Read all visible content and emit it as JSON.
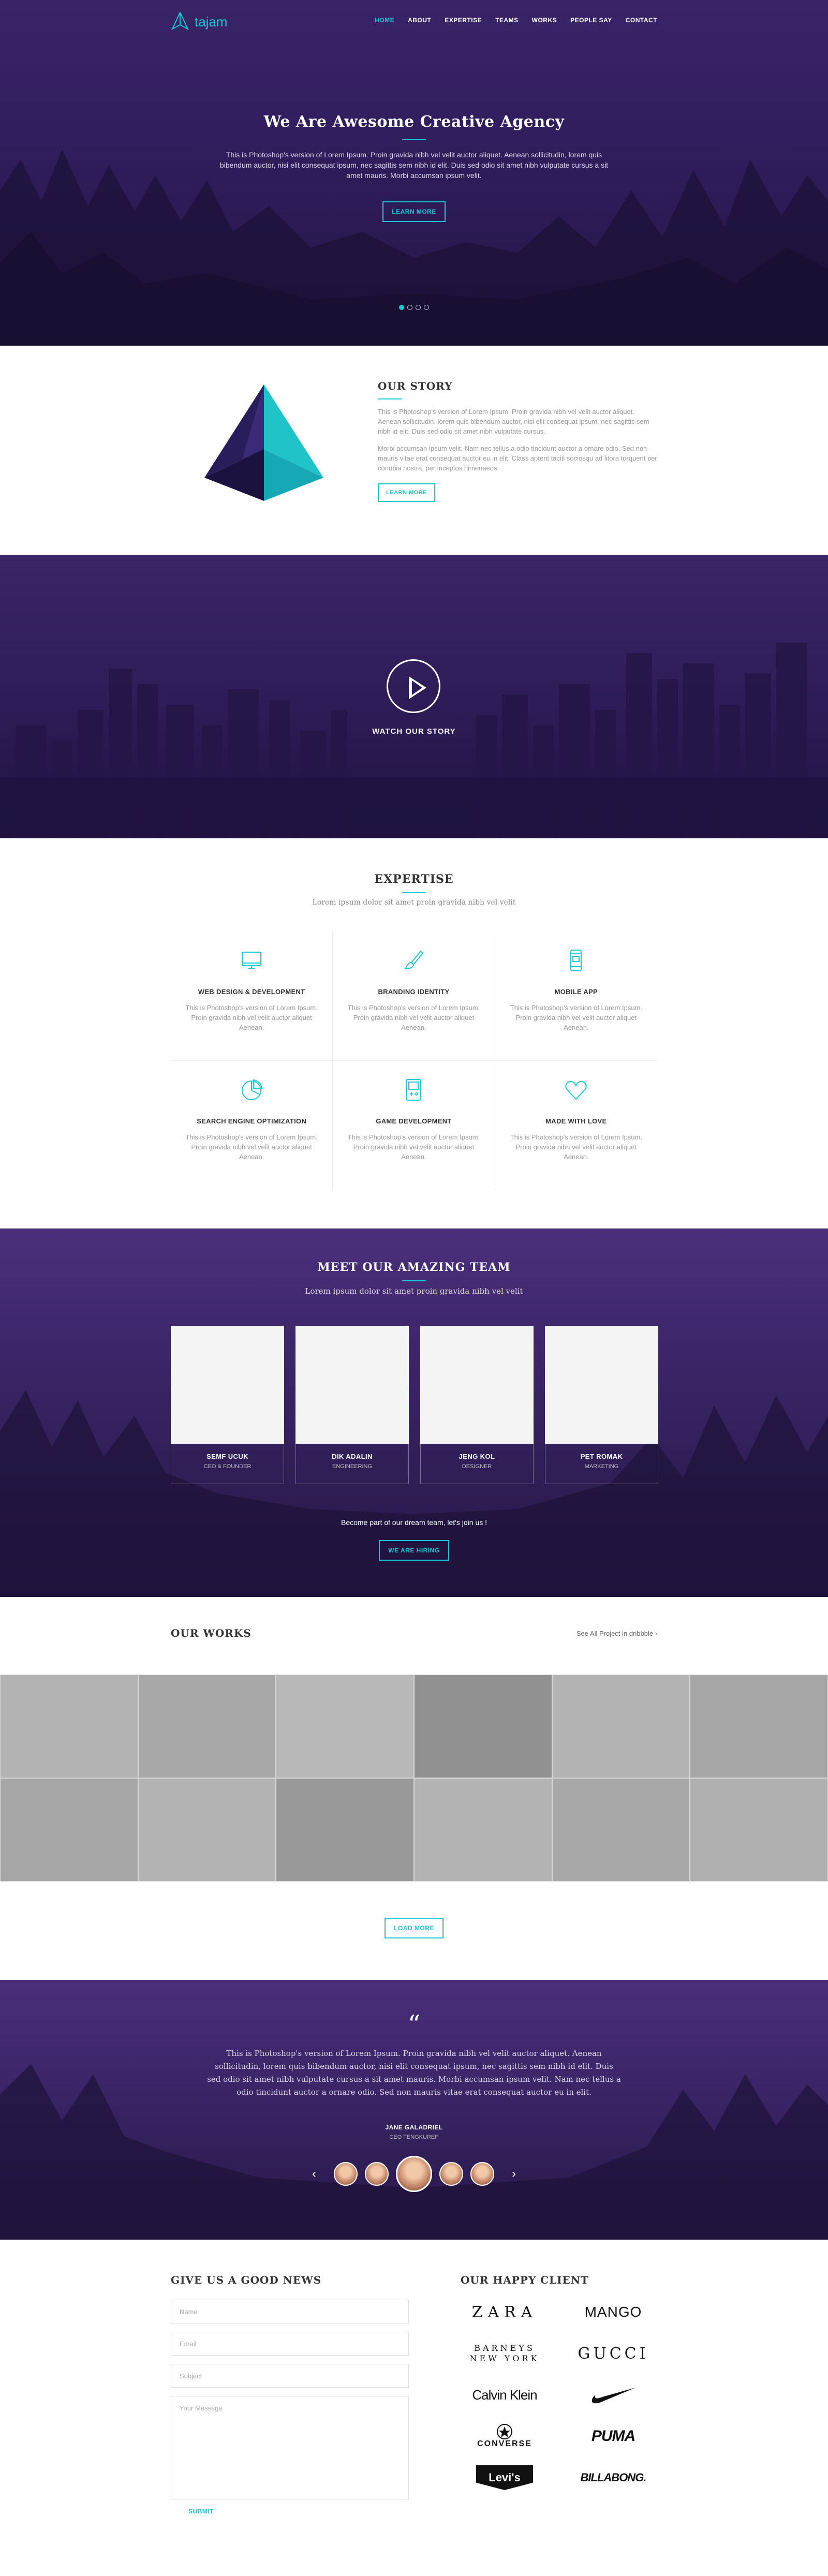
{
  "nav": {
    "logo": "tajam",
    "items": [
      "HOME",
      "ABOUT",
      "EXPERTISE",
      "TEAMS",
      "WORKS",
      "PEOPLE SAY",
      "CONTACT"
    ],
    "active": "HOME"
  },
  "hero": {
    "title": "We Are Awesome Creative Agency",
    "text": "This is Photoshop's version  of Lorem Ipsum. Proin gravida nibh vel velit auctor aliquet. Aenean sollicitudin, lorem quis bibendum auctor, nisi elit consequat ipsum, nec sagittis sem nibh id elit. Duis sed odio sit amet nibh vulputate cursus a sit amet mauris. Morbi accumsan ipsum velit.",
    "button": "LEARN MORE",
    "slides": 4,
    "active_slide": 1
  },
  "story": {
    "title": "OUR STORY",
    "p1": "This is Photoshop's version  of Lorem Ipsum. Proin gravida nibh vel velit auctor aliquet. Aenean sollicitudin, lorem quis bibendum auctor, nisi elit consequat ipsum, nec sagittis sem nibh id elit. Duis sed odio sit amet nibh vulputate cursus.",
    "p2": "Morbi accumsan ipsum velit. Nam nec tellus a odio tincidunt auctor a ornare odio. Sed non  mauris vitae erat consequat auctor eu in elit. Class aptent taciti sociosqu ad litora torquent per conubia nostra, per inceptos himenaeos.",
    "button": "LEARN MORE"
  },
  "video": {
    "label": "WATCH OUR STORY"
  },
  "expertise": {
    "title": "EXPERTISE",
    "subtitle": "Lorem ipsum dolor sit amet proin gravida nibh vel velit",
    "items": [
      {
        "title": "WEB DESIGN & DEVELOPMENT",
        "text": "This is Photoshop's version  of Lorem Ipsum. Proin gravida nibh vel velit auctor aliquet Aenean.",
        "icon": "monitor-icon"
      },
      {
        "title": "BRANDING IDENTITY",
        "text": "This is Photoshop's version  of Lorem Ipsum. Proin gravida nibh vel velit auctor aliquet Aenean.",
        "icon": "brush-icon"
      },
      {
        "title": "MOBILE APP",
        "text": "This is Photoshop's version  of Lorem Ipsum. Proin gravida nibh vel velit auctor aliquet Aenean.",
        "icon": "mobile-icon"
      },
      {
        "title": "SEARCH ENGINE OPTIMIZATION",
        "text": "This is Photoshop's version  of Lorem Ipsum. Proin gravida nibh vel velit auctor aliquet Aenean.",
        "icon": "pie-chart-icon"
      },
      {
        "title": "GAME DEVELOPMENT",
        "text": "This is Photoshop's version  of Lorem Ipsum. Proin gravida nibh vel velit auctor aliquet Aenean.",
        "icon": "gameboy-icon"
      },
      {
        "title": "MADE WITH LOVE",
        "text": "This is Photoshop's version  of Lorem Ipsum. Proin gravida nibh vel velit auctor aliquet Aenean.",
        "icon": "heart-icon"
      }
    ]
  },
  "team": {
    "title": "MEET OUR AMAZING TEAM",
    "subtitle": "Lorem ipsum dolor sit amet proin gravida nibh vel velit",
    "members": [
      {
        "name": "SEMF UCUK",
        "role": "CEO & FOUNDER"
      },
      {
        "name": "DIK ADALIN",
        "role": "ENGINEERING"
      },
      {
        "name": "JENG KOL",
        "role": "DESIGNER"
      },
      {
        "name": "PET ROMAK",
        "role": "MARKETING"
      }
    ],
    "join_text": "Become part of our dream team, let's join us !",
    "button": "WE ARE HIRING"
  },
  "works": {
    "title": "OUR WORKS",
    "all_link": "See All Project in dribbble",
    "tiles": [
      "#b3b3b3",
      "#a8a8a8",
      "#b8b8b8",
      "#919191",
      "#b3b3b3",
      "#a6a6a6",
      "#a6a6a6",
      "#b3b3b3",
      "#999999",
      "#b3b3b3",
      "#a8a8a8",
      "#b0b0b0"
    ],
    "button": "LOAD MORE"
  },
  "testimonial": {
    "quote": "This is Photoshop's version  of Lorem Ipsum. Proin gravida nibh vel velit auctor aliquet. Aenean sollicitudin, lorem quis bibendum auctor, nisi elit consequat ipsum, nec sagittis sem nibh id elit. Duis sed odio sit amet nibh vulputate cursus a sit amet mauris. Morbi accumsan ipsum velit. Nam nec tellus a odio tincidunt auctor a ornare odio. Sed non  mauris vitae erat consequat auctor eu in elit.",
    "author": "JANE GALADRIEL",
    "role": "CEO TENGKUREP",
    "prev": "‹",
    "next": "›"
  },
  "contact": {
    "title": "GIVE US A GOOD NEWS",
    "name_placeholder": "Name",
    "email_placeholder": "Email",
    "subject_placeholder": "Subject",
    "message_placeholder": "Your Message",
    "submit": "SUBMIT"
  },
  "clients": {
    "title": "OUR HAPPY CLIENT",
    "logos": [
      "ZARA",
      "MANGO",
      "BARNEYS NEW YORK",
      "GUCCI",
      "Calvin Klein",
      "Nike",
      "CONVERSE",
      "PUMA",
      "Levi's",
      "BILLABONG."
    ]
  },
  "colors": {
    "accent": "#18c9d3",
    "purple": "#2f1d5c"
  }
}
